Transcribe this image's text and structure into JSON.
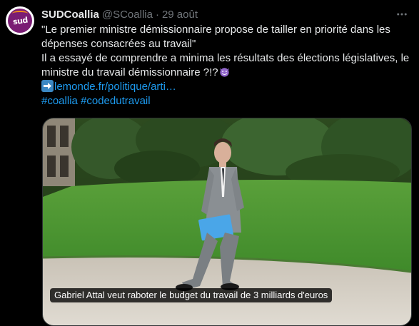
{
  "account": {
    "display_name": "SUDCoallia",
    "handle": "@SCoallia",
    "separator": "·",
    "date": "29 août",
    "avatar_text": "sud"
  },
  "tweet": {
    "line1": "\"Le premier ministre démissionnaire propose de tailler en priorité dans les dépenses consacrées au travail\"",
    "line2": "Il a essayé de comprendre a minima les résultats des élections législatives, le ministre du travail démissionnaire ?!?",
    "link_text": "lemonde.fr/politique/arti…",
    "hashtags": "#coallia #codedutravail"
  },
  "media": {
    "caption": "Gabriel Attal veut raboter le budget du travail de 3 milliards d'euros"
  },
  "icons": {
    "more": "more-options-icon",
    "devil": "smiling-devil-emoji",
    "arrow": "right-arrow-emoji"
  },
  "colors": {
    "background": "#000000",
    "text": "#e7e9ea",
    "muted": "#71767b",
    "link": "#1d9bf0",
    "avatar_purple": "#7a1c74"
  }
}
